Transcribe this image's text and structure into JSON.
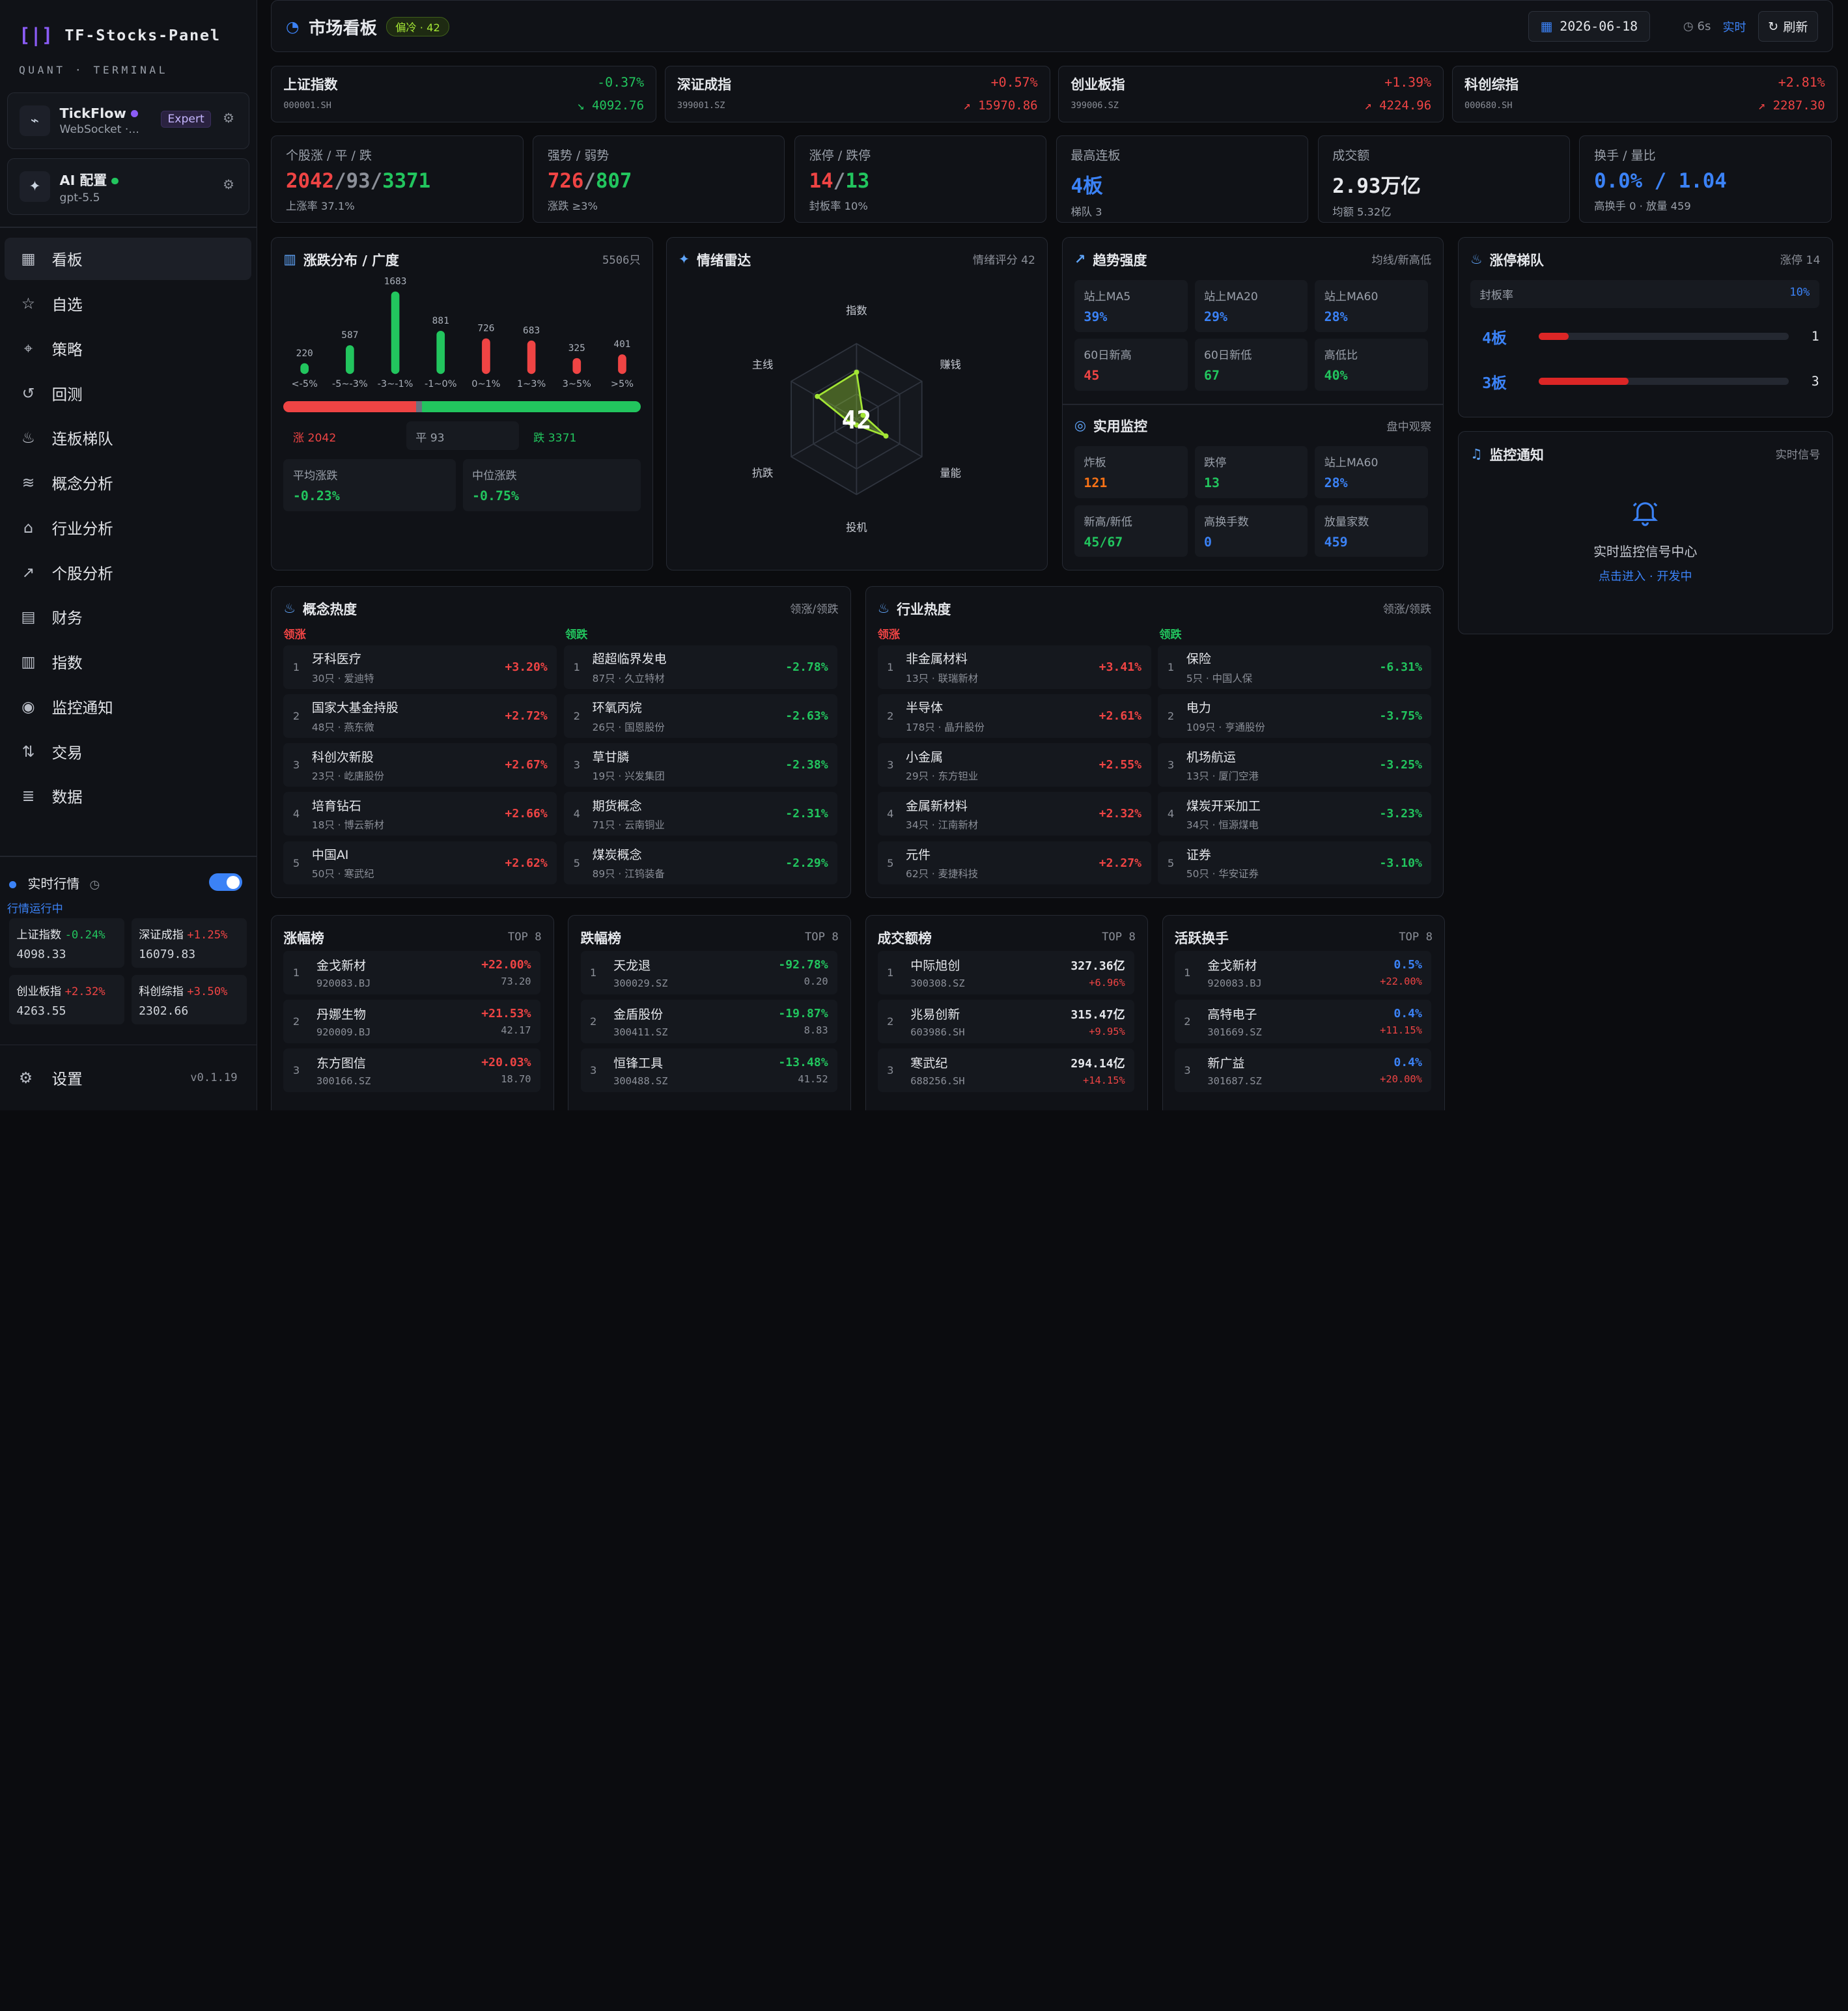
{
  "app": {
    "logo_glyph": "[|]",
    "name": "TF-Stocks-Panel",
    "subtitle": "QUANT · TERMINAL"
  },
  "sources": [
    {
      "name": "TickFlow",
      "sub": "WebSocket ·...",
      "badge": "Expert",
      "dot": "#8b5cf6",
      "icon": "link-icon"
    },
    {
      "name": "AI 配置",
      "sub": "gpt-5.5",
      "dot": "#22c55e",
      "icon": "sparkle-icon"
    }
  ],
  "nav": [
    {
      "label": "看板",
      "icon": "grid-icon",
      "active": true
    },
    {
      "label": "自选",
      "icon": "star-icon"
    },
    {
      "label": "策略",
      "icon": "scan-icon"
    },
    {
      "label": "回测",
      "icon": "history-icon"
    },
    {
      "label": "连板梯队",
      "icon": "flame-icon"
    },
    {
      "label": "概念分析",
      "icon": "layers-icon"
    },
    {
      "label": "行业分析",
      "icon": "bank-icon"
    },
    {
      "label": "个股分析",
      "icon": "trend-icon"
    },
    {
      "label": "财务",
      "icon": "file-icon"
    },
    {
      "label": "指数",
      "icon": "bar-icon"
    },
    {
      "label": "监控通知",
      "icon": "radio-icon"
    },
    {
      "label": "交易",
      "icon": "trade-icon"
    },
    {
      "label": "数据",
      "icon": "database-icon"
    }
  ],
  "realtime": {
    "label": "实时行情",
    "status": "行情运行中",
    "toggle_on": true,
    "minis": [
      {
        "name": "上证指数",
        "chg": "-0.24%",
        "val": "4098.33",
        "up": false
      },
      {
        "name": "深证成指",
        "chg": "+1.25%",
        "val": "16079.83",
        "up": true
      },
      {
        "name": "创业板指",
        "chg": "+2.32%",
        "val": "4263.55",
        "up": true
      },
      {
        "name": "科创综指",
        "chg": "+3.50%",
        "val": "2302.66",
        "up": true
      }
    ]
  },
  "settings": {
    "label": "设置",
    "version": "v0.1.19"
  },
  "header": {
    "title": "市场看板",
    "badge": "偏冷 · 42",
    "date": "2026-06-18",
    "interval": "6s",
    "live": "实时",
    "refresh": "刷新"
  },
  "indices": [
    {
      "name": "上证指数",
      "code": "000001.SH",
      "pct": "-0.37%",
      "val": "↘ 4092.76",
      "up": false
    },
    {
      "name": "深证成指",
      "code": "399001.SZ",
      "pct": "+0.57%",
      "val": "↗ 15970.86",
      "up": true
    },
    {
      "name": "创业板指",
      "code": "399006.SZ",
      "pct": "+1.39%",
      "val": "↗ 4224.96",
      "up": true
    },
    {
      "name": "科创综指",
      "code": "000680.SH",
      "pct": "+2.81%",
      "val": "↗ 2287.30",
      "up": true
    }
  ],
  "stats": [
    {
      "label": "个股涨 / 平 / 跌",
      "parts": [
        {
          "t": "2042",
          "c": "red"
        },
        {
          "t": "/",
          "c": "muted"
        },
        {
          "t": "93",
          "c": "muted"
        },
        {
          "t": "/",
          "c": "muted"
        },
        {
          "t": "3371",
          "c": "green"
        }
      ],
      "sub": "上涨率 37.1%"
    },
    {
      "label": "强势 / 弱势",
      "parts": [
        {
          "t": "726",
          "c": "red"
        },
        {
          "t": "/",
          "c": "muted"
        },
        {
          "t": "807",
          "c": "green"
        }
      ],
      "sub": "涨跌 ≥3%"
    },
    {
      "label": "涨停 / 跌停",
      "parts": [
        {
          "t": "14",
          "c": "red"
        },
        {
          "t": "/",
          "c": "muted"
        },
        {
          "t": "13",
          "c": "green"
        }
      ],
      "sub": "封板率 10%"
    },
    {
      "label": "最高连板",
      "parts": [
        {
          "t": "4板",
          "c": "blue"
        }
      ],
      "sub": "梯队 3"
    },
    {
      "label": "成交额",
      "parts": [
        {
          "t": "2.93万亿",
          "c": "white"
        }
      ],
      "sub": "均额 5.32亿"
    },
    {
      "label": "换手 / 量比",
      "parts": [
        {
          "t": "0.0% / 1.04",
          "c": "blue"
        }
      ],
      "sub": "高换手 0 · 放量 459"
    }
  ],
  "distribution": {
    "title": "涨跌分布 / 广度",
    "count": "5506只",
    "chart_data": {
      "type": "bar",
      "categories": [
        "<-5%",
        "-5~-3%",
        "-3~-1%",
        "-1~0%",
        "0~1%",
        "1~3%",
        "3~5%",
        ">5%"
      ],
      "values": [
        220,
        587,
        1683,
        881,
        726,
        683,
        325,
        401
      ],
      "colors": [
        "#22c55e",
        "#22c55e",
        "#22c55e",
        "#22c55e",
        "#ef4444",
        "#ef4444",
        "#ef4444",
        "#ef4444"
      ]
    },
    "breadth": {
      "up": 2042,
      "flat": 93,
      "down": 3371
    },
    "up_label": "涨 2042",
    "flat_label": "平 93",
    "down_label": "跌 3371",
    "avg_label": "平均涨跌",
    "avg": "-0.23%",
    "med_label": "中位涨跌",
    "med": "-0.75%"
  },
  "radar": {
    "title": "情绪雷达",
    "score_label": "情绪评分 42",
    "score": "42",
    "chart_data": {
      "type": "radar",
      "axes": [
        "指数",
        "赚钱",
        "量能",
        "投机",
        "抗跌",
        "主线"
      ],
      "values": [
        0.62,
        0.1,
        0.45,
        0.08,
        0.1,
        0.6
      ]
    }
  },
  "trend": {
    "title": "趋势强度",
    "right": "均线/新高低",
    "items": [
      {
        "l": "站上MA5",
        "v": "39%",
        "c": "blue"
      },
      {
        "l": "站上MA20",
        "v": "29%",
        "c": "blue"
      },
      {
        "l": "站上MA60",
        "v": "28%",
        "c": "blue"
      },
      {
        "l": "60日新高",
        "v": "45",
        "c": "red"
      },
      {
        "l": "60日新低",
        "v": "67",
        "c": "green"
      },
      {
        "l": "高低比",
        "v": "40%",
        "c": "green"
      }
    ]
  },
  "monitor": {
    "title": "实用监控",
    "right": "盘中观察",
    "items": [
      {
        "l": "炸板",
        "v": "121",
        "c": "orange"
      },
      {
        "l": "跌停",
        "v": "13",
        "c": "green"
      },
      {
        "l": "站上MA60",
        "v": "28%",
        "c": "blue"
      },
      {
        "l": "新高/新低",
        "v": "45/67",
        "c": "green"
      },
      {
        "l": "高换手数",
        "v": "0",
        "c": "blue"
      },
      {
        "l": "放量家数",
        "v": "459",
        "c": "blue"
      }
    ]
  },
  "ladder": {
    "title": "涨停梯队",
    "right": "涨停 14",
    "seal_label": "封板率",
    "seal": "10%",
    "rows": [
      {
        "label": "4板",
        "fill": 0.12,
        "count": "1"
      },
      {
        "label": "3板",
        "fill": 0.36,
        "count": "3"
      }
    ]
  },
  "notify": {
    "title": "监控通知",
    "right": "实时信号",
    "center": "实时监控信号中心",
    "link": "点击进入 · 开发中"
  },
  "concept": {
    "title": "概念热度",
    "right": "领涨/领跌",
    "lead_up": "领涨",
    "lead_down": "领跌",
    "up": [
      {
        "n": "牙科医疗",
        "s": "30只 · 爱迪特",
        "v": "+3.20%"
      },
      {
        "n": "国家大基金持股",
        "s": "48只 · 燕东微",
        "v": "+2.72%"
      },
      {
        "n": "科创次新股",
        "s": "23只 · 屹唐股份",
        "v": "+2.67%"
      },
      {
        "n": "培育钻石",
        "s": "18只 · 博云新材",
        "v": "+2.66%"
      },
      {
        "n": "中国AI",
        "s": "50只 · 寒武纪",
        "v": "+2.62%"
      }
    ],
    "down": [
      {
        "n": "超超临界发电",
        "s": "87只 · 久立特材",
        "v": "-2.78%"
      },
      {
        "n": "环氧丙烷",
        "s": "26只 · 国恩股份",
        "v": "-2.63%"
      },
      {
        "n": "草甘膦",
        "s": "19只 · 兴发集团",
        "v": "-2.38%"
      },
      {
        "n": "期货概念",
        "s": "71只 · 云南铜业",
        "v": "-2.31%"
      },
      {
        "n": "煤炭概念",
        "s": "89只 · 江钨装备",
        "v": "-2.29%"
      }
    ]
  },
  "industry": {
    "title": "行业热度",
    "right": "领涨/领跌",
    "lead_up": "领涨",
    "lead_down": "领跌",
    "up": [
      {
        "n": "非金属材料",
        "s": "13只 · 联瑞新材",
        "v": "+3.41%"
      },
      {
        "n": "半导体",
        "s": "178只 · 晶升股份",
        "v": "+2.61%"
      },
      {
        "n": "小金属",
        "s": "29只 · 东方钽业",
        "v": "+2.55%"
      },
      {
        "n": "金属新材料",
        "s": "34只 · 江南新材",
        "v": "+2.32%"
      },
      {
        "n": "元件",
        "s": "62只 · 麦捷科技",
        "v": "+2.27%"
      }
    ],
    "down": [
      {
        "n": "保险",
        "s": "5只 · 中国人保",
        "v": "-6.31%"
      },
      {
        "n": "电力",
        "s": "109只 · 亨通股份",
        "v": "-3.75%"
      },
      {
        "n": "机场航运",
        "s": "13只 · 厦门空港",
        "v": "-3.25%"
      },
      {
        "n": "煤炭开采加工",
        "s": "34只 · 恒源煤电",
        "v": "-3.23%"
      },
      {
        "n": "证券",
        "s": "50只 · 华安证券",
        "v": "-3.10%"
      }
    ]
  },
  "rankings": [
    {
      "title": "涨幅榜",
      "right": "TOP 8",
      "rows": [
        {
          "n": "金戈新材",
          "c": "920083.BJ",
          "v": "+22.00%",
          "v2": "73.20",
          "vc": "red",
          "v2c": "muted"
        },
        {
          "n": "丹娜生物",
          "c": "920009.BJ",
          "v": "+21.53%",
          "v2": "42.17",
          "vc": "red",
          "v2c": "muted"
        },
        {
          "n": "东方图信",
          "c": "300166.SZ",
          "v": "+20.03%",
          "v2": "18.70",
          "vc": "red",
          "v2c": "muted"
        }
      ]
    },
    {
      "title": "跌幅榜",
      "right": "TOP 8",
      "rows": [
        {
          "n": "天龙退",
          "c": "300029.SZ",
          "v": "-92.78%",
          "v2": "0.20",
          "vc": "green",
          "v2c": "muted"
        },
        {
          "n": "金盾股份",
          "c": "300411.SZ",
          "v": "-19.87%",
          "v2": "8.83",
          "vc": "green",
          "v2c": "muted"
        },
        {
          "n": "恒锋工具",
          "c": "300488.SZ",
          "v": "-13.48%",
          "v2": "41.52",
          "vc": "green",
          "v2c": "muted"
        }
      ]
    },
    {
      "title": "成交额榜",
      "right": "TOP 8",
      "rows": [
        {
          "n": "中际旭创",
          "c": "300308.SZ",
          "v": "327.36亿",
          "v2": "+6.96%",
          "vc": "white",
          "v2c": "red"
        },
        {
          "n": "兆易创新",
          "c": "603986.SH",
          "v": "315.47亿",
          "v2": "+9.95%",
          "vc": "white",
          "v2c": "red"
        },
        {
          "n": "寒武纪",
          "c": "688256.SH",
          "v": "294.14亿",
          "v2": "+14.15%",
          "vc": "white",
          "v2c": "red"
        }
      ]
    },
    {
      "title": "活跃换手",
      "right": "TOP 8",
      "rows": [
        {
          "n": "金戈新材",
          "c": "920083.BJ",
          "v": "0.5%",
          "v2": "+22.00%",
          "vc": "blue",
          "v2c": "red"
        },
        {
          "n": "高特电子",
          "c": "301669.SZ",
          "v": "0.4%",
          "v2": "+11.15%",
          "vc": "blue",
          "v2c": "red"
        },
        {
          "n": "新广益",
          "c": "301687.SZ",
          "v": "0.4%",
          "v2": "+20.00%",
          "vc": "blue",
          "v2c": "red"
        }
      ]
    }
  ]
}
